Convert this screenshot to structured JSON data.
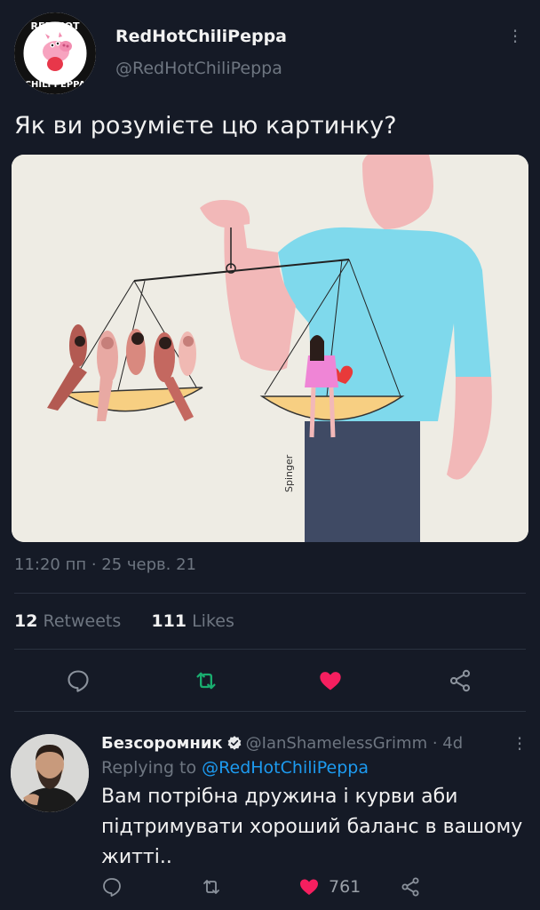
{
  "tweet": {
    "display_name": "RedHotChiliPeppa",
    "handle": "@RedHotChiliPeppa",
    "avatar_text": "RED HOT CHILI PEPPA",
    "text": "Як ви розумієте цю картинку?",
    "timestamp": "11:20 пп · 25 черв. 21",
    "retweets_count": "12",
    "retweets_label": "Retweets",
    "likes_count": "111",
    "likes_label": "Likes",
    "image_signature": "Spinger"
  },
  "actions": [
    {
      "icon": "reply-icon"
    },
    {
      "icon": "retweet-icon",
      "color": "#19ad6f"
    },
    {
      "icon": "heart-icon",
      "color": "#f51f5f"
    },
    {
      "icon": "share-icon"
    }
  ],
  "reply": {
    "display_name": "Безсоромник",
    "handle_time": "@IanShamelessGrimm · 4d",
    "replying_to_label": "Replying to",
    "replying_to_handle": "@RedHotChiliPeppa",
    "text": "Вам потрібна дружина і курви аби підтримувати хороший баланс в вашому житті..",
    "likes": "761",
    "like_color": "#f51f5f"
  },
  "colors": {
    "background": "#151a26",
    "muted": "#6e7681",
    "link": "#1d9bf0"
  }
}
